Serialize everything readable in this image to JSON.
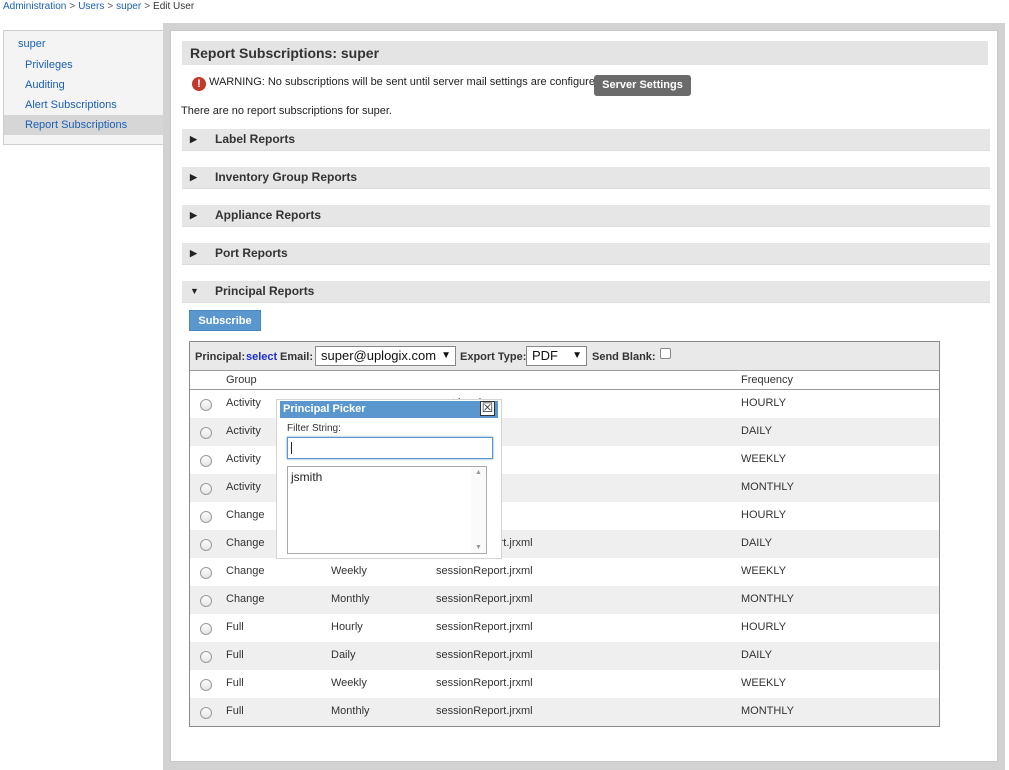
{
  "breadcrumb": {
    "administration": "Administration",
    "users": "Users",
    "user": "super",
    "current": "Edit User",
    "separator": ">"
  },
  "sidebar": {
    "user": "super",
    "items": [
      {
        "label": "Privileges"
      },
      {
        "label": "Auditing"
      },
      {
        "label": "Alert Subscriptions"
      },
      {
        "label": "Report Subscriptions"
      }
    ]
  },
  "panel": {
    "title": "Report Subscriptions: super",
    "warning_icon": "!",
    "warning": "WARNING: No subscriptions will be sent until server mail settings are configured.",
    "server_settings_label": "Server Settings",
    "no_subscriptions": "There are no report subscriptions for super."
  },
  "sections": [
    {
      "title": "Label Reports",
      "arrow": "▶"
    },
    {
      "title": "Inventory Group Reports",
      "arrow": "▶"
    },
    {
      "title": "Appliance Reports",
      "arrow": "▶"
    },
    {
      "title": "Port Reports",
      "arrow": "▶"
    },
    {
      "title": "Principal Reports",
      "arrow": "▼"
    }
  ],
  "principal": {
    "subscribe_label": "Subscribe",
    "principal_label": "Principal:",
    "select_link": "select",
    "email_label": "Email:",
    "email_value": "super@uplogix.com",
    "export_label": "Export Type:",
    "export_value": "PDF",
    "send_blank_label": "Send Blank:",
    "caret": "▼",
    "columns": {
      "group": "Group",
      "frequency": "Frequency"
    },
    "rows": [
      {
        "group": "Activity",
        "interval": "",
        "report": "port.jrxml",
        "frequency": "HOURLY"
      },
      {
        "group": "Activity",
        "interval": "",
        "report": "port.jrxml",
        "frequency": "DAILY"
      },
      {
        "group": "Activity",
        "interval": "",
        "report": "port.jrxml",
        "frequency": "WEEKLY"
      },
      {
        "group": "Activity",
        "interval": "",
        "report": "port.jrxml",
        "frequency": "MONTHLY"
      },
      {
        "group": "Change",
        "interval": "",
        "report": "port.jrxml",
        "frequency": "HOURLY"
      },
      {
        "group": "Change",
        "interval": "Daily",
        "report": "sessionReport.jrxml",
        "frequency": "DAILY"
      },
      {
        "group": "Change",
        "interval": "Weekly",
        "report": "sessionReport.jrxml",
        "frequency": "WEEKLY"
      },
      {
        "group": "Change",
        "interval": "Monthly",
        "report": "sessionReport.jrxml",
        "frequency": "MONTHLY"
      },
      {
        "group": "Full",
        "interval": "Hourly",
        "report": "sessionReport.jrxml",
        "frequency": "HOURLY"
      },
      {
        "group": "Full",
        "interval": "Daily",
        "report": "sessionReport.jrxml",
        "frequency": "DAILY"
      },
      {
        "group": "Full",
        "interval": "Weekly",
        "report": "sessionReport.jrxml",
        "frequency": "WEEKLY"
      },
      {
        "group": "Full",
        "interval": "Monthly",
        "report": "sessionReport.jrxml",
        "frequency": "MONTHLY"
      }
    ]
  },
  "picker": {
    "title": "Principal Picker",
    "close": "☒",
    "filter_label": "Filter String:",
    "filter_value": "",
    "items": [
      {
        "label": "jsmith"
      }
    ],
    "scroll_up": "▲",
    "scroll_down": "▼"
  }
}
